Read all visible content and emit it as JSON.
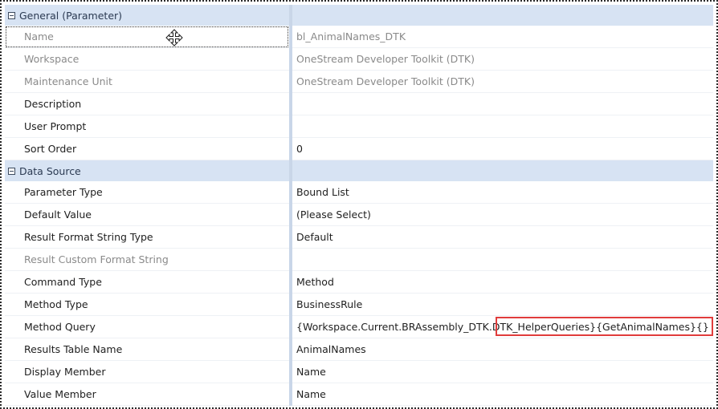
{
  "categories": {
    "general": "General (Parameter)",
    "data_source": "Data Source"
  },
  "general_rows": [
    {
      "name": "Name",
      "value": "bl_AnimalNames_DTK"
    },
    {
      "name": "Workspace",
      "value": "OneStream Developer Toolkit (DTK)"
    },
    {
      "name": "Maintenance Unit",
      "value": "OneStream Developer Toolkit (DTK)"
    },
    {
      "name": "Description",
      "value": ""
    },
    {
      "name": "User Prompt",
      "value": ""
    },
    {
      "name": "Sort Order",
      "value": "0"
    }
  ],
  "data_source_rows": [
    {
      "name": "Parameter Type",
      "value": "Bound List"
    },
    {
      "name": "Default Value",
      "value": "(Please Select)"
    },
    {
      "name": "Result Format String Type",
      "value": "Default"
    },
    {
      "name": "Result Custom Format String",
      "value": ""
    },
    {
      "name": "Command Type",
      "value": "Method"
    },
    {
      "name": "Method Type",
      "value": "BusinessRule"
    },
    {
      "name": "Method Query",
      "value": "{Workspace.Current.BRAssembly_DTK.DTK_HelperQueries}{GetAnimalNames}{}"
    },
    {
      "name": "Results Table Name",
      "value": "AnimalNames"
    },
    {
      "name": "Display Member",
      "value": "Name"
    },
    {
      "name": "Value Member",
      "value": "Name"
    }
  ],
  "icons": {
    "collapse": "collapse-minus-icon",
    "cursor": "move-cursor-icon"
  },
  "colors": {
    "category_bg": "#d7e3f3",
    "highlight_border": "#e03c3c",
    "disabled_text": "#8a8a8a"
  }
}
